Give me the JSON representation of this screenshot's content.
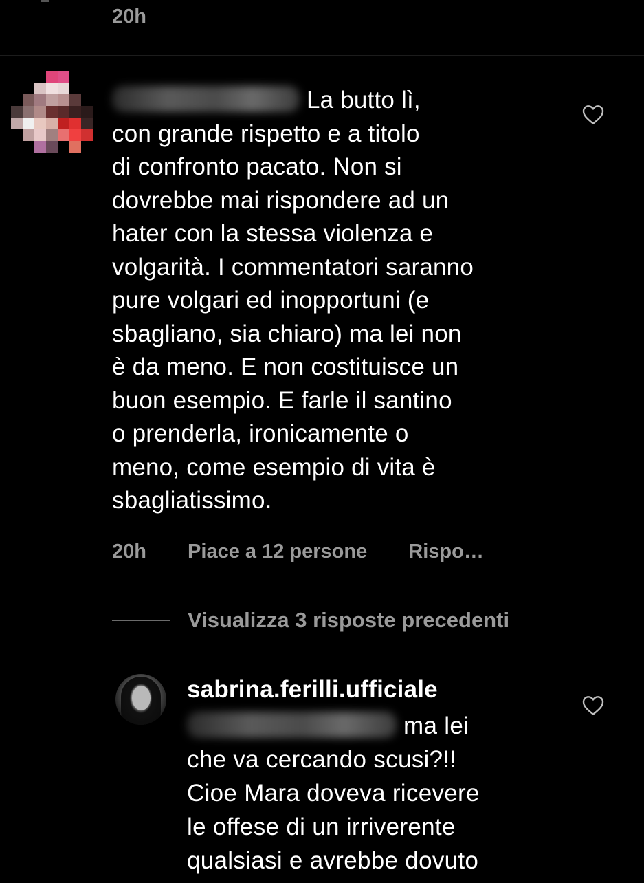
{
  "top": {
    "time": "20h"
  },
  "comment": {
    "first_line_after_mention": "La butto lì,",
    "lines": [
      "con grande rispetto e a titolo",
      "di confronto pacato. Non si",
      "dovrebbe mai rispondere ad un",
      "hater con la stessa violenza e",
      "volgarità. I commentatori saranno",
      "pure volgari ed inopportuni (e",
      "sbagliano, sia chiaro) ma lei non",
      "è da meno. E non costituisce un",
      "buon esempio. E farle il santino",
      "o prenderla, ironicamente o",
      "meno, come esempio di vita è",
      "sbagliatissimo."
    ],
    "time": "20h",
    "likes": "Piace a 12 persone",
    "reply": "Rispo…",
    "like_icon": "heart-outline-icon"
  },
  "replies_toggle": {
    "label": "Visualizza 3 risposte precedenti"
  },
  "reply": {
    "username": "sabrina.ferilli.ufficiale",
    "first_line_after_mention": "ma lei",
    "lines": [
      "che va cercando scusi?!!",
      "Cioe Mara doveva ricevere",
      "le offese di un irriverente",
      "qualsiasi e avrebbe dovuto"
    ],
    "like_icon": "heart-outline-icon"
  },
  "colors": {
    "background": "#000000",
    "text": "#ffffff",
    "secondary_text": "#9a9a9a"
  }
}
